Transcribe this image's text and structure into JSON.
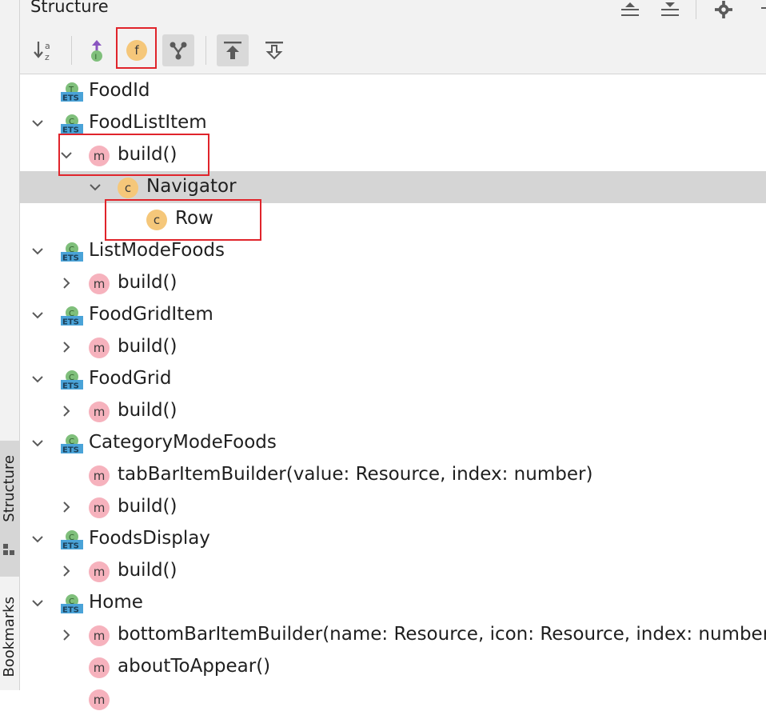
{
  "panel": {
    "title": "Structure"
  },
  "left_strip": {
    "tabs": [
      {
        "label": "Structure",
        "active": true
      },
      {
        "label": "Bookmarks",
        "active": false
      }
    ]
  },
  "toolbar": {
    "buttons": [
      {
        "icon": "sort-alphabetically-icon",
        "pressed": false
      },
      {
        "icon": "show-inherited-icon",
        "pressed": false
      },
      {
        "icon": "show-fields-icon",
        "pressed": false,
        "highlighted": true
      },
      {
        "icon": "show-nonpublic-icon",
        "pressed": true
      },
      {
        "icon": "autoscroll-to-source-icon",
        "pressed": true
      },
      {
        "icon": "autoscroll-from-source-icon",
        "pressed": false
      }
    ]
  },
  "header_icons": [
    "expand-all-icon",
    "collapse-all-icon",
    "gear-icon",
    "hide-icon"
  ],
  "tree": [
    {
      "label": "FoodId",
      "kind": "ets-type",
      "indent": 0,
      "expander": "none"
    },
    {
      "label": "FoodListItem",
      "kind": "ets-class",
      "indent": 0,
      "expander": "expanded"
    },
    {
      "label": "build()",
      "kind": "method",
      "indent": 1,
      "expander": "expanded",
      "highlighted": true
    },
    {
      "label": "Navigator",
      "kind": "component",
      "indent": 2,
      "expander": "expanded",
      "selected": true
    },
    {
      "label": "Row",
      "kind": "component",
      "indent": 3,
      "expander": "none",
      "highlighted": true
    },
    {
      "label": "ListModeFoods",
      "kind": "ets-class",
      "indent": 0,
      "expander": "expanded"
    },
    {
      "label": "build()",
      "kind": "method",
      "indent": 1,
      "expander": "collapsed"
    },
    {
      "label": "FoodGridItem",
      "kind": "ets-class",
      "indent": 0,
      "expander": "expanded"
    },
    {
      "label": "build()",
      "kind": "method",
      "indent": 1,
      "expander": "collapsed"
    },
    {
      "label": "FoodGrid",
      "kind": "ets-class",
      "indent": 0,
      "expander": "expanded"
    },
    {
      "label": "build()",
      "kind": "method",
      "indent": 1,
      "expander": "collapsed"
    },
    {
      "label": "CategoryModeFoods",
      "kind": "ets-class",
      "indent": 0,
      "expander": "expanded"
    },
    {
      "label": "tabBarItemBuilder(value: Resource, index: number)",
      "kind": "method",
      "indent": 1,
      "expander": "none"
    },
    {
      "label": "build()",
      "kind": "method",
      "indent": 1,
      "expander": "collapsed"
    },
    {
      "label": "FoodsDisplay",
      "kind": "ets-class",
      "indent": 0,
      "expander": "expanded"
    },
    {
      "label": "build()",
      "kind": "method",
      "indent": 1,
      "expander": "collapsed"
    },
    {
      "label": "Home",
      "kind": "ets-class",
      "indent": 0,
      "expander": "expanded"
    },
    {
      "label": "bottomBarItemBuilder(name: Resource, icon: Resource, index: number)",
      "kind": "method",
      "indent": 1,
      "expander": "collapsed"
    },
    {
      "label": "aboutToAppear()",
      "kind": "method",
      "indent": 1,
      "expander": "none"
    },
    {
      "label": "",
      "kind": "method",
      "indent": 1,
      "expander": "none"
    }
  ],
  "colors": {
    "highlight": "#e0242b",
    "selected_row": "#d5d5d5",
    "method_badge": "#f6b2bd",
    "component_badge": "#f5c77a",
    "ets_green": "#7fbf7b",
    "ets_blue": "#4aa3d8"
  }
}
